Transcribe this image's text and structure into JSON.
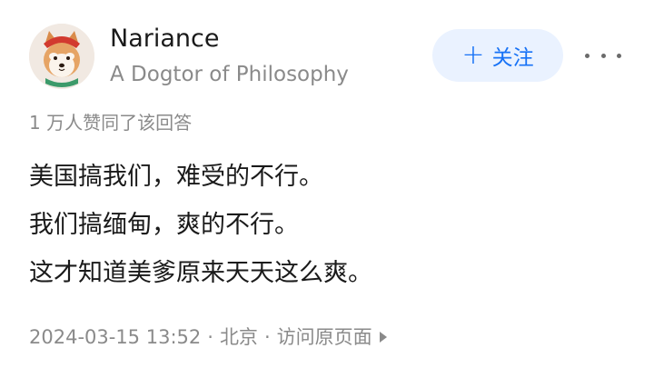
{
  "author": {
    "name": "Nariance",
    "headline": "A Dogtor of Philosophy"
  },
  "follow_button": {
    "plus": "+",
    "label": "关注"
  },
  "more_icon": "more-dots-icon",
  "upvote_summary": "1 万人赞同了该回答",
  "content": {
    "lines": [
      "美国搞我们，难受的不行。",
      "我们搞缅甸，爽的不行。",
      "这才知道美爹原来天天这么爽。"
    ]
  },
  "meta": {
    "timestamp": "2024-03-15 13:52",
    "separator": "·",
    "location": "北京",
    "link_label": "访问原页面"
  },
  "colors": {
    "accent": "#1772f6",
    "follow_bg": "#eaf2ff",
    "text": "#1a1a1a",
    "muted": "#8a8a8a"
  }
}
